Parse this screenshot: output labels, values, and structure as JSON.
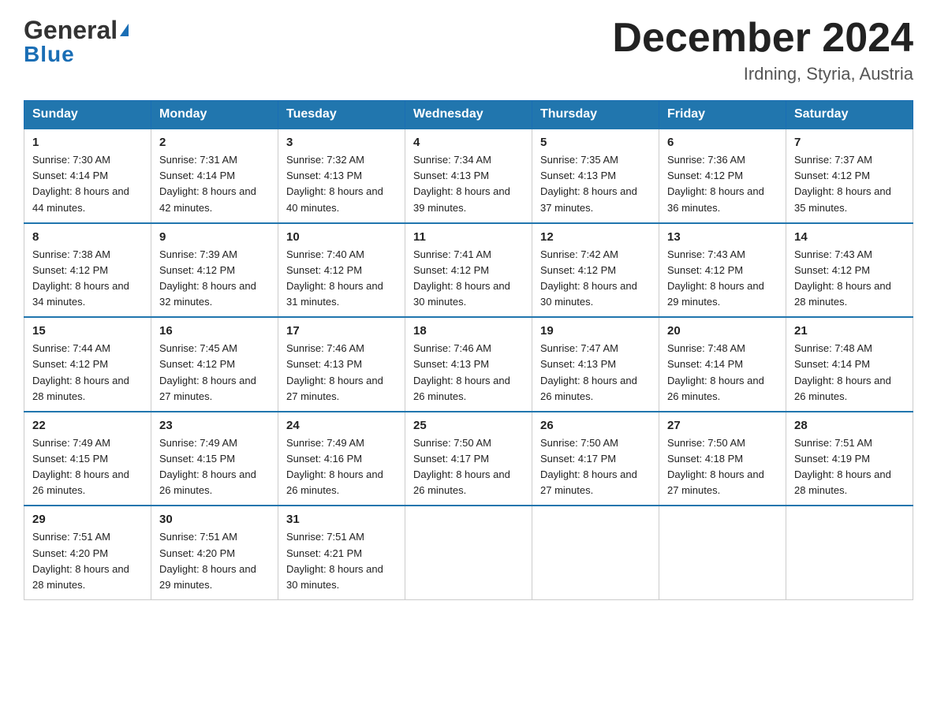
{
  "header": {
    "logo_general": "General",
    "logo_blue": "Blue",
    "month_title": "December 2024",
    "location": "Irdning, Styria, Austria"
  },
  "days_of_week": [
    "Sunday",
    "Monday",
    "Tuesday",
    "Wednesday",
    "Thursday",
    "Friday",
    "Saturday"
  ],
  "weeks": [
    [
      {
        "day": "1",
        "sunrise": "7:30 AM",
        "sunset": "4:14 PM",
        "daylight": "8 hours and 44 minutes."
      },
      {
        "day": "2",
        "sunrise": "7:31 AM",
        "sunset": "4:14 PM",
        "daylight": "8 hours and 42 minutes."
      },
      {
        "day": "3",
        "sunrise": "7:32 AM",
        "sunset": "4:13 PM",
        "daylight": "8 hours and 40 minutes."
      },
      {
        "day": "4",
        "sunrise": "7:34 AM",
        "sunset": "4:13 PM",
        "daylight": "8 hours and 39 minutes."
      },
      {
        "day": "5",
        "sunrise": "7:35 AM",
        "sunset": "4:13 PM",
        "daylight": "8 hours and 37 minutes."
      },
      {
        "day": "6",
        "sunrise": "7:36 AM",
        "sunset": "4:12 PM",
        "daylight": "8 hours and 36 minutes."
      },
      {
        "day": "7",
        "sunrise": "7:37 AM",
        "sunset": "4:12 PM",
        "daylight": "8 hours and 35 minutes."
      }
    ],
    [
      {
        "day": "8",
        "sunrise": "7:38 AM",
        "sunset": "4:12 PM",
        "daylight": "8 hours and 34 minutes."
      },
      {
        "day": "9",
        "sunrise": "7:39 AM",
        "sunset": "4:12 PM",
        "daylight": "8 hours and 32 minutes."
      },
      {
        "day": "10",
        "sunrise": "7:40 AM",
        "sunset": "4:12 PM",
        "daylight": "8 hours and 31 minutes."
      },
      {
        "day": "11",
        "sunrise": "7:41 AM",
        "sunset": "4:12 PM",
        "daylight": "8 hours and 30 minutes."
      },
      {
        "day": "12",
        "sunrise": "7:42 AM",
        "sunset": "4:12 PM",
        "daylight": "8 hours and 30 minutes."
      },
      {
        "day": "13",
        "sunrise": "7:43 AM",
        "sunset": "4:12 PM",
        "daylight": "8 hours and 29 minutes."
      },
      {
        "day": "14",
        "sunrise": "7:43 AM",
        "sunset": "4:12 PM",
        "daylight": "8 hours and 28 minutes."
      }
    ],
    [
      {
        "day": "15",
        "sunrise": "7:44 AM",
        "sunset": "4:12 PM",
        "daylight": "8 hours and 28 minutes."
      },
      {
        "day": "16",
        "sunrise": "7:45 AM",
        "sunset": "4:12 PM",
        "daylight": "8 hours and 27 minutes."
      },
      {
        "day": "17",
        "sunrise": "7:46 AM",
        "sunset": "4:13 PM",
        "daylight": "8 hours and 27 minutes."
      },
      {
        "day": "18",
        "sunrise": "7:46 AM",
        "sunset": "4:13 PM",
        "daylight": "8 hours and 26 minutes."
      },
      {
        "day": "19",
        "sunrise": "7:47 AM",
        "sunset": "4:13 PM",
        "daylight": "8 hours and 26 minutes."
      },
      {
        "day": "20",
        "sunrise": "7:48 AM",
        "sunset": "4:14 PM",
        "daylight": "8 hours and 26 minutes."
      },
      {
        "day": "21",
        "sunrise": "7:48 AM",
        "sunset": "4:14 PM",
        "daylight": "8 hours and 26 minutes."
      }
    ],
    [
      {
        "day": "22",
        "sunrise": "7:49 AM",
        "sunset": "4:15 PM",
        "daylight": "8 hours and 26 minutes."
      },
      {
        "day": "23",
        "sunrise": "7:49 AM",
        "sunset": "4:15 PM",
        "daylight": "8 hours and 26 minutes."
      },
      {
        "day": "24",
        "sunrise": "7:49 AM",
        "sunset": "4:16 PM",
        "daylight": "8 hours and 26 minutes."
      },
      {
        "day": "25",
        "sunrise": "7:50 AM",
        "sunset": "4:17 PM",
        "daylight": "8 hours and 26 minutes."
      },
      {
        "day": "26",
        "sunrise": "7:50 AM",
        "sunset": "4:17 PM",
        "daylight": "8 hours and 27 minutes."
      },
      {
        "day": "27",
        "sunrise": "7:50 AM",
        "sunset": "4:18 PM",
        "daylight": "8 hours and 27 minutes."
      },
      {
        "day": "28",
        "sunrise": "7:51 AM",
        "sunset": "4:19 PM",
        "daylight": "8 hours and 28 minutes."
      }
    ],
    [
      {
        "day": "29",
        "sunrise": "7:51 AM",
        "sunset": "4:20 PM",
        "daylight": "8 hours and 28 minutes."
      },
      {
        "day": "30",
        "sunrise": "7:51 AM",
        "sunset": "4:20 PM",
        "daylight": "8 hours and 29 minutes."
      },
      {
        "day": "31",
        "sunrise": "7:51 AM",
        "sunset": "4:21 PM",
        "daylight": "8 hours and 30 minutes."
      },
      null,
      null,
      null,
      null
    ]
  ]
}
